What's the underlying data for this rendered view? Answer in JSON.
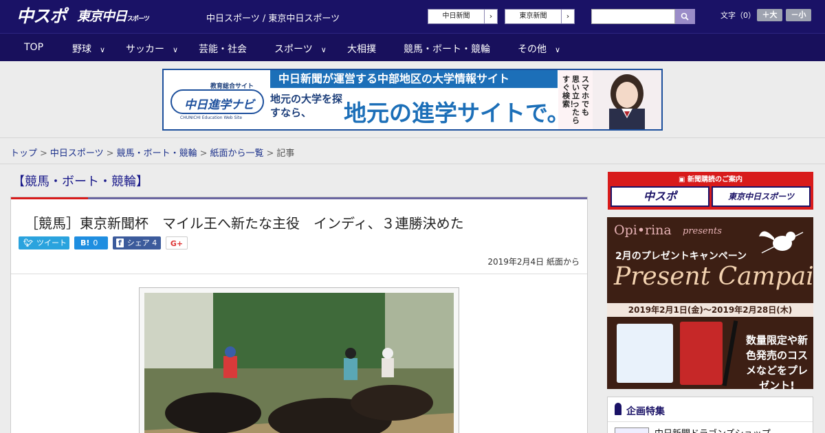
{
  "header": {
    "logo_chuspo": "中スポ",
    "logo_tokyo": "東京中日",
    "logo_tokyo_suffix": "スポーツ",
    "site_links": "中日スポーツ / 東京中日スポーツ",
    "buttons": [
      {
        "label": "中日新聞"
      },
      {
        "label": "東京新聞"
      }
    ],
    "search": {
      "value": "",
      "placeholder": ""
    },
    "fontsize_label": "文字（0）",
    "font_larger": "＋大",
    "font_smaller": "－小"
  },
  "nav": [
    {
      "label": "TOP",
      "dropdown": false
    },
    {
      "label": "野球",
      "dropdown": true
    },
    {
      "label": "サッカー",
      "dropdown": true
    },
    {
      "label": "芸能・社会",
      "dropdown": false
    },
    {
      "label": "スポーツ",
      "dropdown": true
    },
    {
      "label": "大相撲",
      "dropdown": false
    },
    {
      "label": "競馬・ボート・競輪",
      "dropdown": false
    },
    {
      "label": "その他",
      "dropdown": true
    }
  ],
  "banner": {
    "logo_top": "教育総合サイト",
    "logo_name": "中日進学ナビ",
    "logo_sub": "CHUNICHI Education Web Site",
    "headline": "中日新聞が運営する中部地区の大学情報サイト",
    "left_text": "地元の大学を探すなら、",
    "big_text": "地元の進学サイトで。",
    "vertical_text": [
      "スマホでも",
      "思い立ったら",
      "すぐ検索！"
    ]
  },
  "breadcrumb": [
    {
      "label": "トップ",
      "link": true
    },
    {
      "label": "中日スポーツ",
      "link": true
    },
    {
      "label": "競馬・ボート・競輪",
      "link": true
    },
    {
      "label": "紙面から一覧",
      "link": true
    },
    {
      "label": "記事",
      "link": false
    }
  ],
  "breadcrumb_sep": ">",
  "section_title": "【競馬・ボート・競輪】",
  "article": {
    "title": "［競馬］東京新聞杯　マイル王へ新たな主役　インディ、３連勝決めた",
    "share": {
      "tweet": "ツイート",
      "hatena_icon": "B!",
      "hatena_count": "0",
      "facebook_icon": "f",
      "facebook_label": "シェア",
      "facebook_count": "4",
      "gplus": "G+"
    },
    "date": "2019年2月4日 紙面から"
  },
  "sidebar": {
    "subscribe_head": "新聞購読のご案内",
    "subscribe_chuspo": "中スポ",
    "subscribe_tokyo": "東京中日スポーツ",
    "ad": {
      "brand": "Opi•rina",
      "presents": "presents",
      "campaign_jp": "2月のプレゼントキャンペーン",
      "campaign_en": "Present Campaign",
      "date_range": "2019年2月1日(金)～2019年2月28日(木)",
      "promo": "数量限定や新色発売のコスメなどをプレゼント!"
    },
    "feature_title": "企画特集",
    "feature_link": "中日新聞ドラゴンズショップ"
  },
  "colors": {
    "header_bg": "#1a1266",
    "nav_bg": "#18105c",
    "accent_red": "#d81b1b",
    "link_blue": "#1a2f8a"
  }
}
